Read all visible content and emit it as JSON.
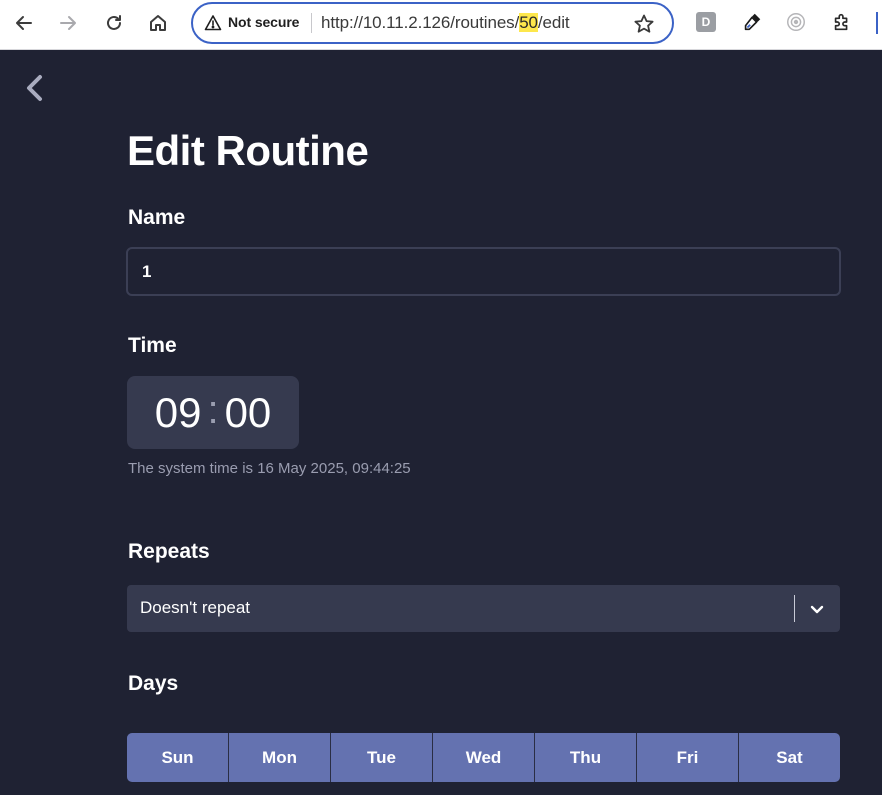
{
  "browser": {
    "security_label": "Not secure",
    "url_prefix": "http://10.11.2.126/routines/",
    "url_highlight": "50",
    "url_suffix": "/edit",
    "extensions": {
      "d_badge": "D"
    }
  },
  "page": {
    "title": "Edit Routine",
    "name": {
      "label": "Name",
      "value": "1"
    },
    "time": {
      "label": "Time",
      "hours": "09",
      "separator": ":",
      "minutes": "00",
      "system_time_text": "The system time is 16 May 2025, 09:44:25"
    },
    "repeats": {
      "label": "Repeats",
      "selected": "Doesn't repeat"
    },
    "days": {
      "label": "Days",
      "items": [
        "Sun",
        "Mon",
        "Tue",
        "Wed",
        "Thu",
        "Fri",
        "Sat"
      ]
    }
  },
  "colors": {
    "background": "#1f2233",
    "surface": "#363a4f",
    "day_button": "#6472b0",
    "omnibox_focus": "#3b62c6",
    "url_highlight": "#fde74c"
  }
}
